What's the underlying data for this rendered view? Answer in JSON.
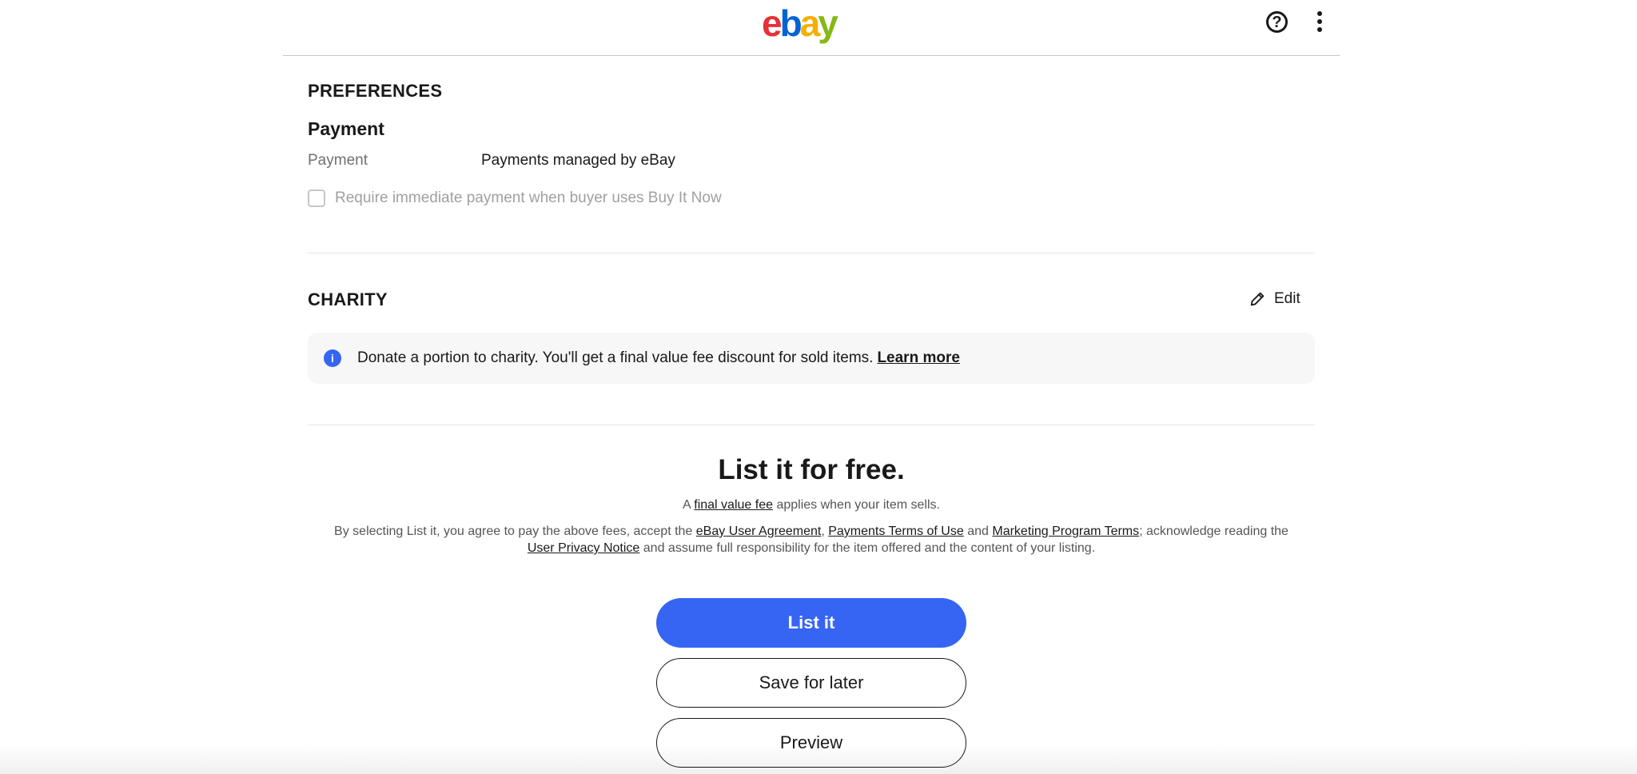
{
  "header": {
    "logo_letters": [
      "e",
      "b",
      "a",
      "y"
    ],
    "logo_colors": [
      "#e53238",
      "#0064d2",
      "#f5af02",
      "#86b817"
    ],
    "help_icon": "help-icon",
    "more_icon": "more-vertical-icon"
  },
  "preferences": {
    "title": "PREFERENCES",
    "payment_heading": "Payment",
    "payment_label": "Payment",
    "payment_value": "Payments managed by eBay",
    "immediate_payment_label": "Require immediate payment when buyer uses Buy It Now",
    "immediate_payment_checked": false
  },
  "charity": {
    "title": "CHARITY",
    "edit_label": "Edit",
    "info_text": "Donate a portion to charity. You'll get a final value fee discount for sold items.",
    "learn_more": "Learn more"
  },
  "listing": {
    "title": "List it for free.",
    "fee_prefix": "A",
    "fee_link": "final value fee",
    "fee_suffix": "applies when your item sells.",
    "legal_1": "By selecting List it, you agree to pay the above fees, accept the",
    "link_user_agreement": "eBay User Agreement",
    "legal_comma": ",",
    "link_payments_terms": "Payments Terms of Use",
    "legal_and": "and",
    "link_marketing_terms": "Marketing Program Terms",
    "legal_2": "; acknowledge reading the",
    "link_privacy": "User Privacy Notice",
    "legal_3": "and assume full responsibility for the item offered and the content of your listing."
  },
  "actions": {
    "list_it": "List it",
    "save_for_later": "Save for later",
    "preview": "Preview"
  },
  "colors": {
    "primary": "#3665f3",
    "text": "#191919",
    "muted": "#707070"
  }
}
